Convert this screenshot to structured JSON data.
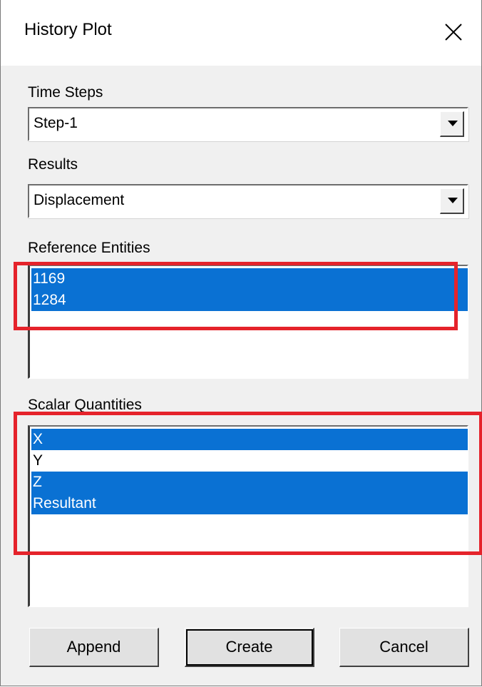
{
  "window": {
    "title": "History Plot",
    "close_icon": "close-icon"
  },
  "time_steps": {
    "label": "Time Steps",
    "value": "Step-1"
  },
  "results": {
    "label": "Results",
    "value": "Displacement"
  },
  "reference_entities": {
    "label": "Reference Entities",
    "items": [
      {
        "text": "1169",
        "selected": true
      },
      {
        "text": "1284",
        "selected": true
      }
    ]
  },
  "scalar_quantities": {
    "label": "Scalar Quantities",
    "items": [
      {
        "text": "X",
        "selected": true
      },
      {
        "text": "Y",
        "selected": false
      },
      {
        "text": "Z",
        "selected": true
      },
      {
        "text": "Resultant",
        "selected": true
      }
    ]
  },
  "buttons": {
    "append": "Append",
    "create": "Create",
    "cancel": "Cancel"
  },
  "colors": {
    "selection": "#0a71d3",
    "annotation_box": "#e5232b"
  }
}
